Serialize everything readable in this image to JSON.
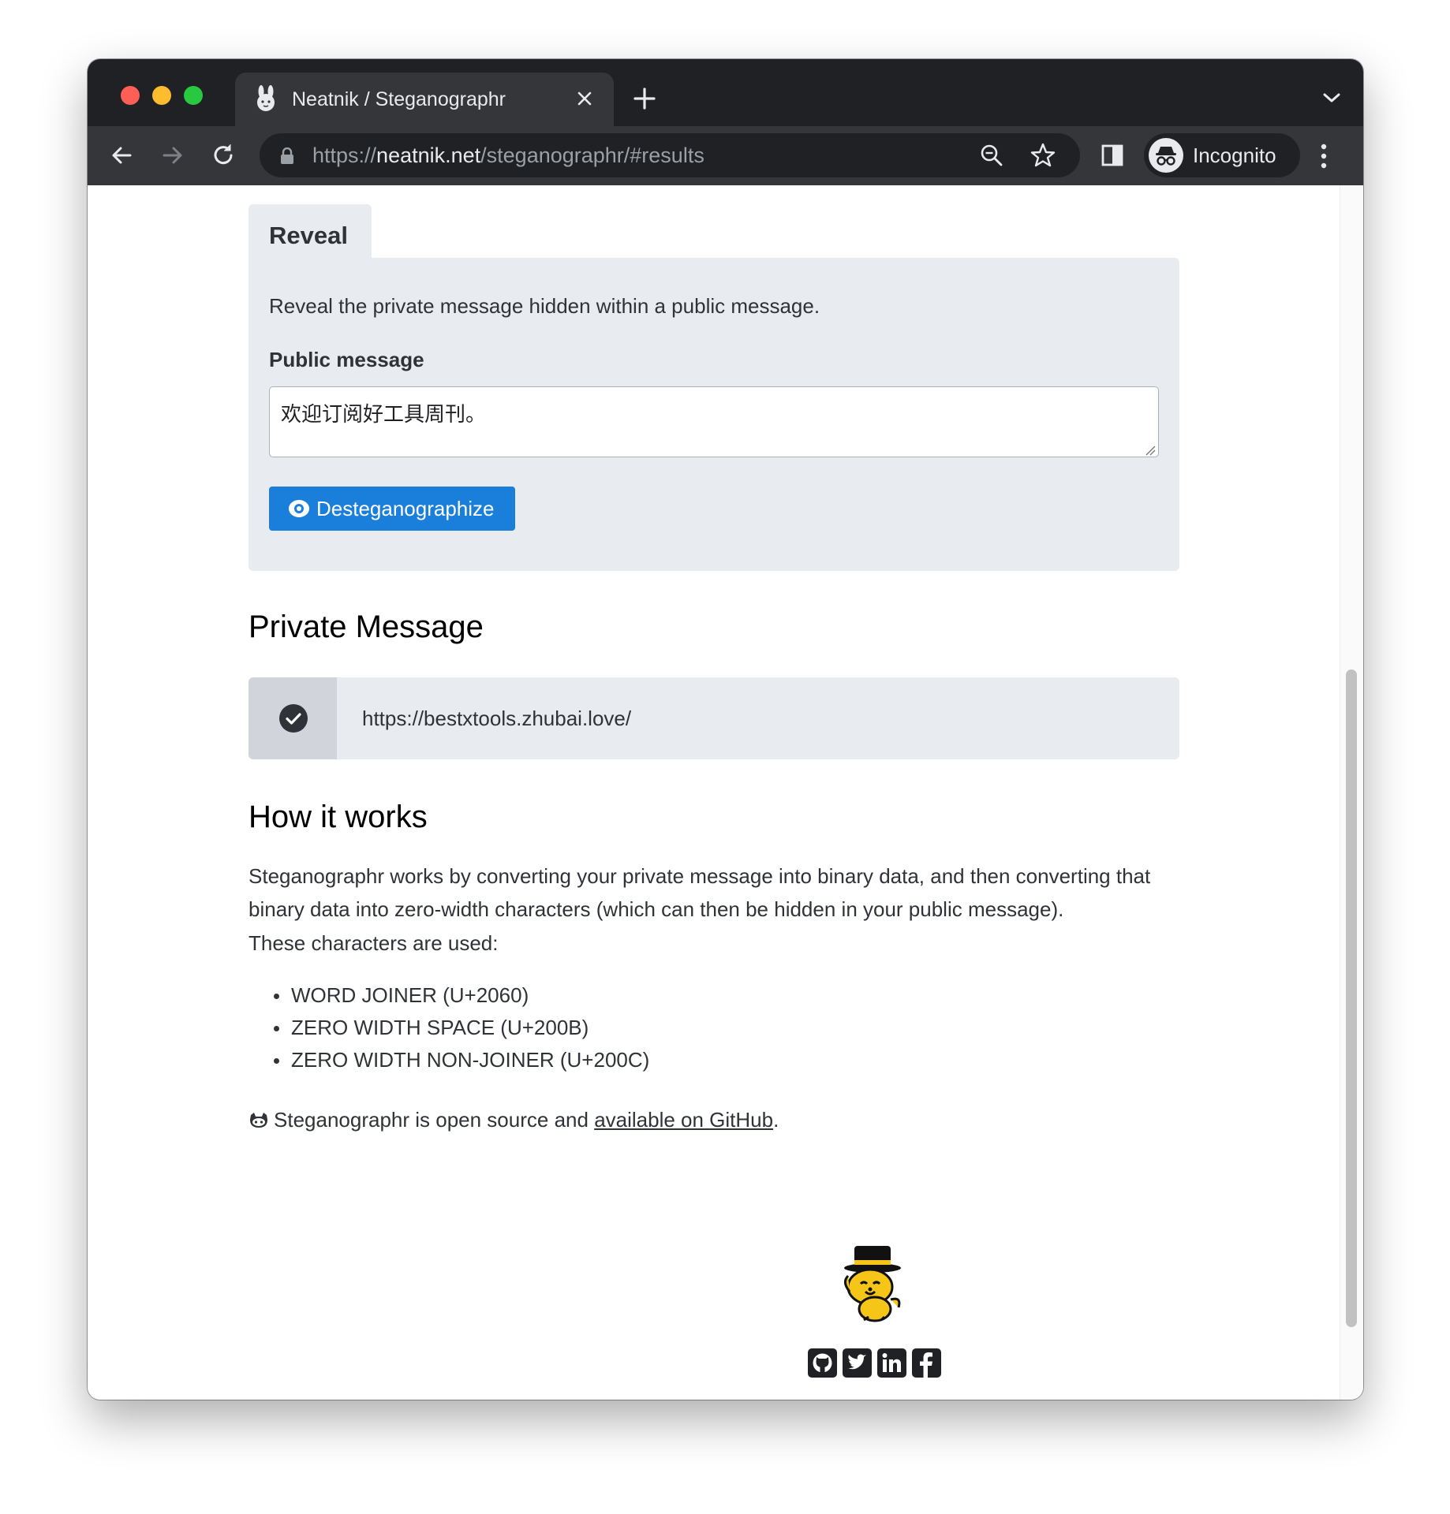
{
  "browser": {
    "tab_title": "Neatnik / Steganographr",
    "url_scheme": "https://",
    "url_host": "neatnik.net",
    "url_path": "/steganographr/#results",
    "profile_label": "Incognito"
  },
  "reveal": {
    "tab_label": "Reveal",
    "description": "Reveal the private message hidden within a public message.",
    "field_label": "Public message",
    "field_value": "欢迎订阅好工具周刊。",
    "button_label": "Desteganographize"
  },
  "private_message": {
    "heading": "Private Message",
    "value": "https://bestxtools.zhubai.love/"
  },
  "how_it_works": {
    "heading": "How it works",
    "paragraph": "Steganographr works by converting your private message into binary data, and then converting that binary data into zero-width characters (which can then be hidden in your public message).",
    "chars_intro": "These characters are used:",
    "characters": [
      "WORD JOINER (U+2060)",
      "ZERO WIDTH SPACE (U+200B)",
      "ZERO WIDTH NON-JOINER (U+200C)"
    ],
    "open_source_text": "Steganographr is open source and ",
    "github_link": "available on GitHub",
    "open_source_end": "."
  },
  "colors": {
    "primary_button": "#1a7fdb",
    "panel_bg": "#e8ebef",
    "browser_frame": "#202124"
  },
  "icons": [
    "bunny-favicon-icon",
    "close-icon",
    "plus-icon",
    "chevron-down-icon",
    "back-arrow-icon",
    "forward-arrow-icon",
    "reload-icon",
    "lock-icon",
    "zoom-icon",
    "star-icon",
    "side-panel-icon",
    "incognito-icon",
    "more-vert-icon",
    "eye-icon",
    "check-circle-icon",
    "octocat-icon",
    "mascot-icon",
    "github-icon",
    "twitter-icon",
    "linkedin-icon",
    "facebook-icon"
  ]
}
